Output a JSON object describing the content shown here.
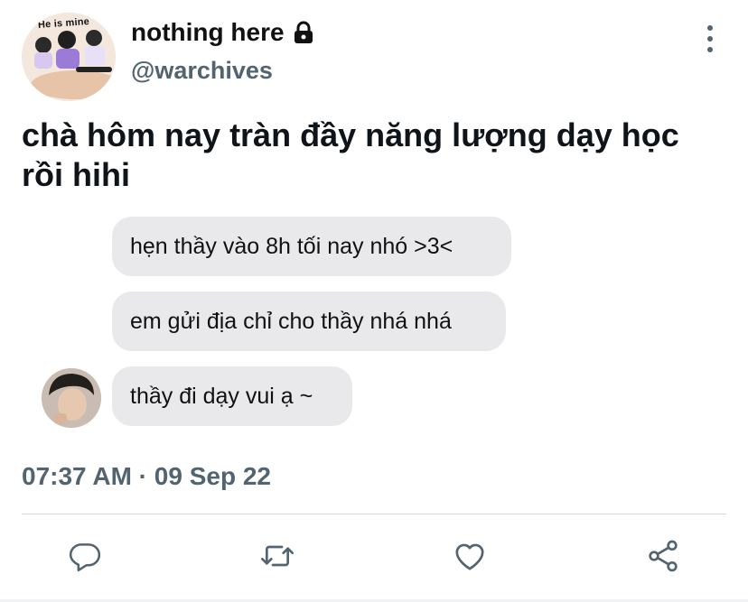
{
  "profile": {
    "avatar_caption": "He is mine",
    "display_name": "nothing here",
    "handle": "@warchives",
    "protected_icon": "lock-icon"
  },
  "tweet": {
    "text": "chà hôm nay tràn đầy năng lượng dạy học rồi hihi",
    "timestamp": "07:37 AM · 09 Sep 22"
  },
  "messages": [
    {
      "text": "hẹn thầy vào 8h tối nay nhó >3<"
    },
    {
      "text": "em gửi địa chỉ cho thầy nhá nhá"
    },
    {
      "text": "thầy đi dạy vui ạ ~"
    }
  ],
  "actions": {
    "reply": "reply-icon",
    "retweet": "retweet-icon",
    "like": "like-icon",
    "share": "share-icon"
  },
  "colors": {
    "text": "#0f1419",
    "secondary": "#536471",
    "bubble": "#e9e9eb",
    "divider": "#cfd9de"
  }
}
